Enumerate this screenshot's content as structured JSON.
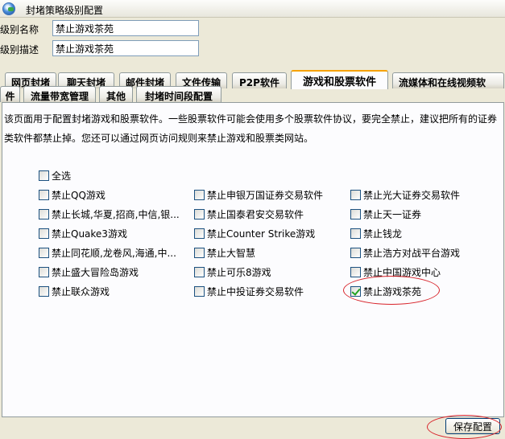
{
  "window": {
    "title": "封堵策略级别配置",
    "icon": "globe-icon"
  },
  "form": {
    "name_label": "级别名称",
    "name_value": "禁止游戏茶苑",
    "desc_label": "级别描述",
    "desc_value": "禁止游戏茶苑"
  },
  "tabs": [
    {
      "label": "网页封堵"
    },
    {
      "label": "聊天封堵"
    },
    {
      "label": "邮件封堵"
    },
    {
      "label": "文件传输"
    },
    {
      "label": "P2P软件"
    },
    {
      "label": "游戏和股票软件",
      "active": true
    },
    {
      "label": "流媒体和在线视频软"
    },
    {
      "label": "件"
    },
    {
      "label": "流量带宽管理"
    },
    {
      "label": "其他"
    },
    {
      "label": "封堵时间段配置"
    }
  ],
  "description": "该页面用于配置封堵游戏和股票软件。一些股票软件可能会使用多个股票软件协议，要完全禁止，建议把所有的证券类软件都禁止掉。您还可以通过网页访问规则来禁止游戏和股票类网站。",
  "select_all": {
    "label": "全选",
    "checked": false
  },
  "options": [
    {
      "label": "禁止QQ游戏",
      "checked": false
    },
    {
      "label": "禁止申银万国证券交易软件",
      "checked": false
    },
    {
      "label": "禁止光大证券交易软件",
      "checked": false
    },
    {
      "label": "禁止长城,华夏,招商,中信,银...",
      "checked": false
    },
    {
      "label": "禁止国泰君安交易软件",
      "checked": false
    },
    {
      "label": "禁止天一证券",
      "checked": false
    },
    {
      "label": "禁止Quake3游戏",
      "checked": false
    },
    {
      "label": "禁止Counter Strike游戏",
      "checked": false
    },
    {
      "label": "禁止钱龙",
      "checked": false
    },
    {
      "label": "禁止同花顺,龙卷风,海通,中...",
      "checked": false
    },
    {
      "label": "禁止大智慧",
      "checked": false
    },
    {
      "label": "禁止浩方对战平台游戏",
      "checked": false
    },
    {
      "label": "禁止盛大冒险岛游戏",
      "checked": false
    },
    {
      "label": "禁止可乐8游戏",
      "checked": false
    },
    {
      "label": "禁止中国游戏中心",
      "checked": false
    },
    {
      "label": "禁止联众游戏",
      "checked": false
    },
    {
      "label": "禁止中投证券交易软件",
      "checked": false
    },
    {
      "label": "禁止游戏茶苑",
      "checked": true
    }
  ],
  "save_button": {
    "label": "保存配置"
  },
  "colors": {
    "active_tab_accent": "#f6a200",
    "highlight_ring": "#d8232a",
    "input_border": "#7f9db9"
  }
}
